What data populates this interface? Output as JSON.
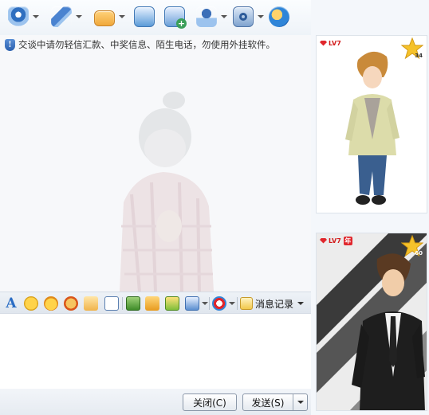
{
  "colors": {
    "accent_blue": "#2a6cc4",
    "level_red": "#e0262c",
    "star_gold": "#f5c22b"
  },
  "toolbar": {
    "items": [
      {
        "name": "video-call",
        "icon": "webcam-icon",
        "color": "#3b78c8"
      },
      {
        "name": "voice-call",
        "icon": "microphone-icon",
        "color": "#4a83d0"
      },
      {
        "name": "send-file",
        "icon": "folder-icon",
        "color": "#f0a83a"
      },
      {
        "name": "send-message",
        "icon": "mail-icon",
        "color": "#5b9bd8"
      },
      {
        "name": "create-group",
        "icon": "group-add-icon",
        "color": "#3b9f5a"
      },
      {
        "name": "remote-assist",
        "icon": "user-monitor-icon",
        "color": "#3b6fb8"
      },
      {
        "name": "app",
        "icon": "settings-app-icon",
        "color": "#5a7fb0"
      },
      {
        "name": "qzone",
        "icon": "qzone-icon",
        "color": "#f08a1e"
      }
    ]
  },
  "notice": {
    "text": "交谈中请勿轻信汇款、中奖信息、陌生电话，勿使用外挂软件。",
    "icon": "shield-icon"
  },
  "format_toolbar": {
    "font_icon": "A",
    "history_label": "消息记录"
  },
  "buttons": {
    "close_label": "关闭(C)",
    "send_label": "发送(S)"
  },
  "show_top": {
    "level": "LV7",
    "star_count": "34"
  },
  "show_bottom": {
    "level": "LV7",
    "year_badge": "年",
    "star_count": "60"
  }
}
